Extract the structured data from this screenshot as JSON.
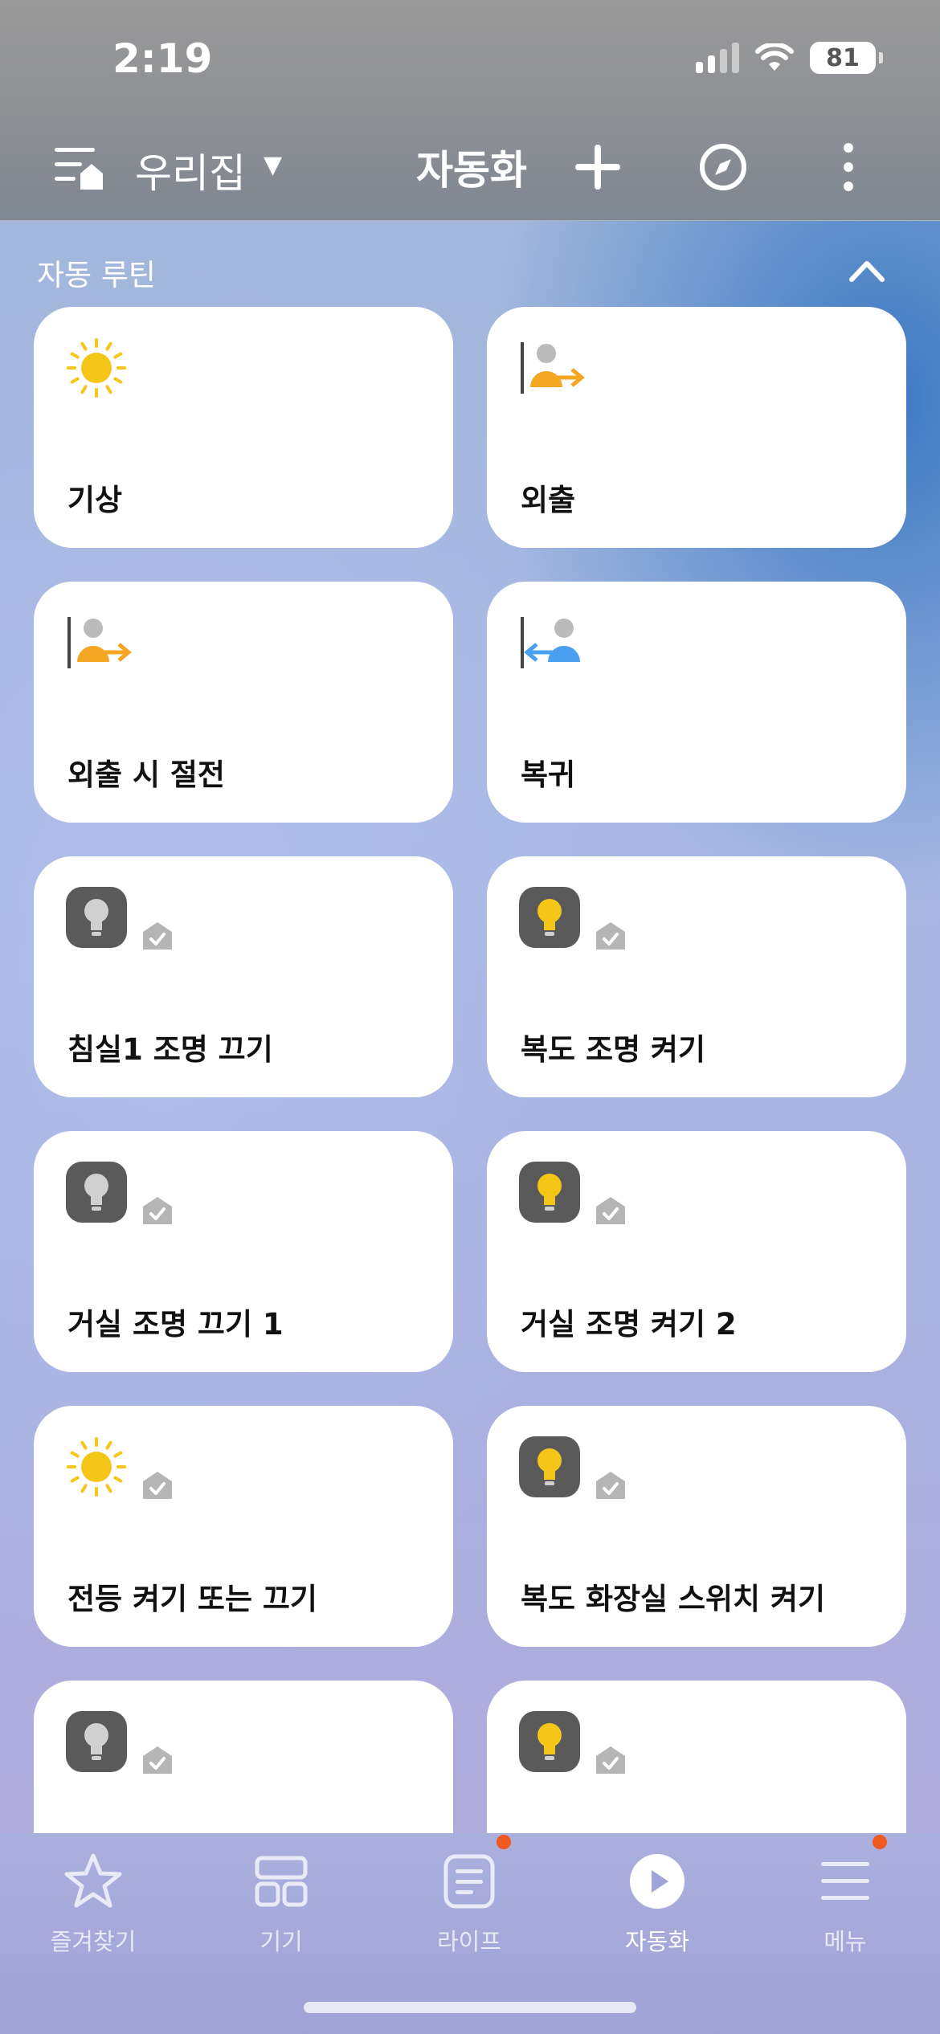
{
  "status": {
    "time": "2:19",
    "battery": "81"
  },
  "header": {
    "home_name": "우리집",
    "home_caret": "▼",
    "title": "자동화"
  },
  "section": {
    "title": "자동 루틴"
  },
  "cards": [
    {
      "label": "기상",
      "icon": "sun-icon"
    },
    {
      "label": "외출",
      "icon": "person-leave-icon"
    },
    {
      "label": "외출 시 절전",
      "icon": "person-leave-icon"
    },
    {
      "label": "복귀",
      "icon": "person-return-icon"
    },
    {
      "label": "침실1 조명 끄기",
      "icon": "bulb-off-icon"
    },
    {
      "label": "복도 조명 켜기",
      "icon": "bulb-on-icon"
    },
    {
      "label": "거실 조명 끄기 1",
      "icon": "bulb-off-icon"
    },
    {
      "label": "거실 조명 켜기 2",
      "icon": "bulb-on-icon"
    },
    {
      "label": "전등 켜기 또는 끄기",
      "icon": "sun-icon"
    },
    {
      "label": "복도 화장실 스위치 켜기",
      "icon": "bulb-on-icon"
    },
    {
      "label": "",
      "icon": "bulb-off-icon"
    },
    {
      "label": "",
      "icon": "bulb-on-icon"
    }
  ],
  "tabs": [
    {
      "label": "즐겨찾기",
      "icon": "star-icon"
    },
    {
      "label": "기기",
      "icon": "devices-icon"
    },
    {
      "label": "라이프",
      "icon": "life-icon"
    },
    {
      "label": "자동화",
      "icon": "play-icon",
      "active": true
    },
    {
      "label": "메뉴",
      "icon": "menu-icon"
    }
  ],
  "colors": {
    "accent_yellow": "#F5C518",
    "orange": "#F5A623",
    "blue": "#4A9FF0",
    "badge": "#EE5A20"
  }
}
